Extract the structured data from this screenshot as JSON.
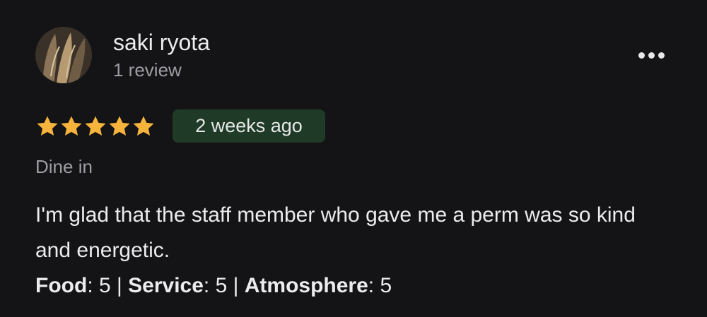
{
  "reviewer": {
    "name": "saki ryota",
    "review_count": "1 review"
  },
  "review": {
    "rating": 5,
    "max_rating": 5,
    "time_ago": "2 weeks ago",
    "service_type": "Dine in",
    "text": "I'm glad that the staff member who gave me a perm was so kind and energetic.",
    "ratings": [
      {
        "label": "Food",
        "value": "5"
      },
      {
        "label": "Service",
        "value": "5"
      },
      {
        "label": "Atmosphere",
        "value": "5"
      }
    ]
  },
  "icons": {
    "star": "star-icon",
    "more": "more-horizontal-icon"
  },
  "colors": {
    "background": "#141416",
    "star": "#f6b43c",
    "badge_bg": "#1f3a27",
    "secondary_text": "#9d9da3"
  }
}
